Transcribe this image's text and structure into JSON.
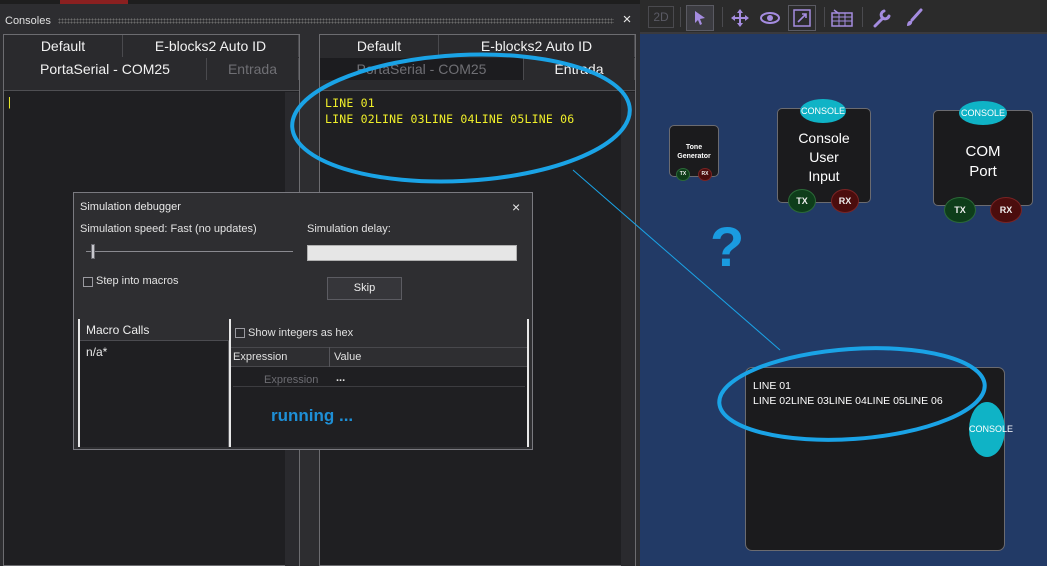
{
  "consoles": {
    "title": "Consoles",
    "close": "×",
    "left_pane": {
      "tabs_row1": [
        "Default",
        "E-blocks2 Auto ID"
      ],
      "tabs_row2": [
        "PortaSerial - COM25",
        "Entrada"
      ],
      "text": "|"
    },
    "right_pane": {
      "tabs_row1": [
        "Default",
        "E-blocks2 Auto ID"
      ],
      "tabs_row2": [
        "PortaSerial - COM25",
        "Entrada"
      ],
      "lines": [
        "LINE 01",
        "LINE 02LINE 03LINE 04LINE 05LINE 06"
      ]
    }
  },
  "debugger": {
    "title": "Simulation debugger",
    "close": "×",
    "speed_label": "Simulation speed: Fast (no updates)",
    "delay_label": "Simulation delay:",
    "delay_value": "",
    "step_into_macros": "Step into macros",
    "skip": "Skip",
    "macro_calls_header": "Macro Calls",
    "macro_calls": [
      "n/a*"
    ],
    "show_hex": "Show integers as hex",
    "col_expression": "Expression",
    "col_value": "Value",
    "expression_placeholder": "Expression",
    "value_placeholder": "...",
    "status": "running ..."
  },
  "toolbar": {
    "view_2d": "2D"
  },
  "panel": {
    "tone_generator": {
      "label": "Tone\nGenerator",
      "tx": "TX",
      "rx": "RX"
    },
    "console_user_input": {
      "label": "Console\nUser\nInput",
      "pill": "CONSOLE",
      "tx": "TX",
      "rx": "RX"
    },
    "com_port": {
      "label": "COM\nPort",
      "pill": "CONSOLE",
      "tx": "TX",
      "rx": "RX"
    },
    "question": "?",
    "display_lines": [
      "LINE 01",
      "LINE 02LINE 03LINE 04LINE 05LINE 06"
    ],
    "display_pill": "CONSOLE"
  },
  "colors": {
    "annotation": "#1aa3e6",
    "console_text": "#f0ef2a",
    "panel_bg": "#223a66"
  }
}
